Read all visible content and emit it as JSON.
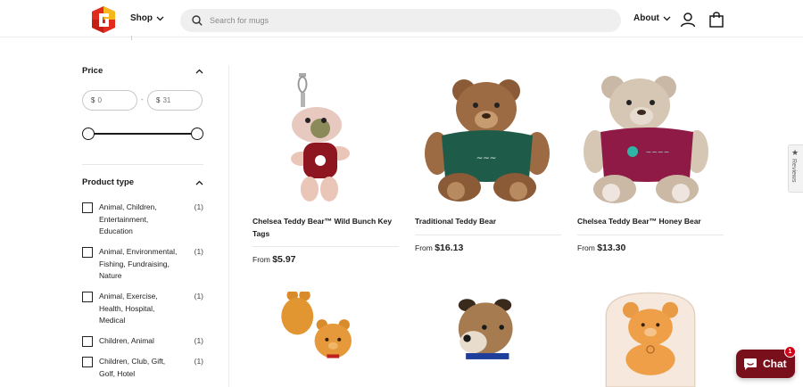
{
  "header": {
    "shop_label": "Shop",
    "search_placeholder": "Search for mugs",
    "about_label": "About"
  },
  "sidebar": {
    "price": {
      "title": "Price",
      "currency": "$",
      "min_placeholder": "0",
      "max_placeholder": "31",
      "dash": "-",
      "range_min_fraction": 0,
      "range_max_fraction": 1
    },
    "product_type": {
      "title": "Product type",
      "items": [
        {
          "label": "Animal, Children, Entertainment, Education",
          "count": "(1)"
        },
        {
          "label": "Animal, Environmental, Fishing, Fundraising, Nature",
          "count": "(1)"
        },
        {
          "label": "Animal, Exercise, Health, Hospital, Medical",
          "count": "(1)"
        },
        {
          "label": "Children, Animal",
          "count": "(1)"
        },
        {
          "label": "Children, Club, Gift, Golf, Hotel",
          "count": "(1)"
        }
      ]
    }
  },
  "products": [
    {
      "name": "Chelsea Teddy Bear™ Wild Bunch Key Tags",
      "price_prefix": "From",
      "price": "$5.97"
    },
    {
      "name": "Traditional Teddy Bear",
      "price_prefix": "From",
      "price": "$16.13"
    },
    {
      "name": "Chelsea Teddy Bear™ Honey Bear",
      "price_prefix": "From",
      "price": "$13.30"
    },
    {
      "name": "",
      "price_prefix": "",
      "price": ""
    },
    {
      "name": "",
      "price_prefix": "",
      "price": ""
    },
    {
      "name": "",
      "price_prefix": "",
      "price": ""
    }
  ],
  "reviews_tab": {
    "label": "Reviews"
  },
  "chat": {
    "label": "Chat",
    "badge": "1"
  },
  "colors": {
    "accent": "#7a0f1c",
    "badge": "#d0021b",
    "logo_red": "#e22b1f",
    "logo_yellow": "#f5b81c"
  }
}
